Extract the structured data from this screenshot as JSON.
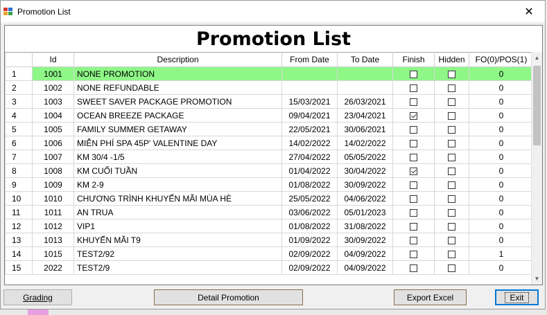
{
  "window": {
    "title": "Promotion List",
    "close_glyph": "✕"
  },
  "heading": "Promotion List",
  "table": {
    "columns": [
      "",
      "Id",
      "Description",
      "From Date",
      "To Date",
      "Finish",
      "Hidden",
      "FO(0)/POS(1)"
    ],
    "rows": [
      {
        "n": "1",
        "id": "1001",
        "desc": "NONE PROMOTION",
        "from": "",
        "to": "",
        "finish": false,
        "hidden": false,
        "fopos": "0",
        "selected": true
      },
      {
        "n": "2",
        "id": "1002",
        "desc": "NONE REFUNDABLE",
        "from": "",
        "to": "",
        "finish": false,
        "hidden": false,
        "fopos": "0"
      },
      {
        "n": "3",
        "id": "1003",
        "desc": "SWEET SAVER PACKAGE PROMOTION",
        "from": "15/03/2021",
        "to": "26/03/2021",
        "finish": false,
        "hidden": false,
        "fopos": "0"
      },
      {
        "n": "4",
        "id": "1004",
        "desc": "OCEAN BREEZE PACKAGE",
        "from": "09/04/2021",
        "to": "23/04/2021",
        "finish": true,
        "hidden": false,
        "fopos": "0"
      },
      {
        "n": "5",
        "id": "1005",
        "desc": "FAMILY SUMMER GETAWAY",
        "from": "22/05/2021",
        "to": "30/06/2021",
        "finish": false,
        "hidden": false,
        "fopos": "0"
      },
      {
        "n": "6",
        "id": "1006",
        "desc": "MIỄN PHÍ SPA 45P' VALENTINE DAY",
        "from": "14/02/2022",
        "to": "14/02/2022",
        "finish": false,
        "hidden": false,
        "fopos": "0"
      },
      {
        "n": "7",
        "id": "1007",
        "desc": "KM 30/4 -1/5",
        "from": "27/04/2022",
        "to": "05/05/2022",
        "finish": false,
        "hidden": false,
        "fopos": "0"
      },
      {
        "n": "8",
        "id": "1008",
        "desc": "KM CUỐI TUẦN",
        "from": "01/04/2022",
        "to": "30/04/2022",
        "finish": true,
        "hidden": false,
        "fopos": "0"
      },
      {
        "n": "9",
        "id": "1009",
        "desc": "KM 2-9",
        "from": "01/08/2022",
        "to": "30/09/2022",
        "finish": false,
        "hidden": false,
        "fopos": "0"
      },
      {
        "n": "10",
        "id": "1010",
        "desc": "CHƯƠNG TRÌNH KHUYẾN MÃI MÙA HÈ",
        "from": "25/05/2022",
        "to": "04/06/2022",
        "finish": false,
        "hidden": false,
        "fopos": "0"
      },
      {
        "n": "11",
        "id": "1011",
        "desc": "AN TRUA",
        "from": "03/06/2022",
        "to": "05/01/2023",
        "finish": false,
        "hidden": false,
        "fopos": "0"
      },
      {
        "n": "12",
        "id": "1012",
        "desc": "VIP1",
        "from": "01/08/2022",
        "to": "31/08/2022",
        "finish": false,
        "hidden": false,
        "fopos": "0"
      },
      {
        "n": "13",
        "id": "1013",
        "desc": "KHUYẾN MÃI T9",
        "from": "01/09/2022",
        "to": "30/09/2022",
        "finish": false,
        "hidden": false,
        "fopos": "0"
      },
      {
        "n": "14",
        "id": "1015",
        "desc": "TEST2/92",
        "from": "02/09/2022",
        "to": "04/09/2022",
        "finish": false,
        "hidden": false,
        "fopos": "1"
      },
      {
        "n": "15",
        "id": "2022",
        "desc": "TEST2/9",
        "from": "02/09/2022",
        "to": "04/09/2022",
        "finish": false,
        "hidden": false,
        "fopos": "0"
      }
    ]
  },
  "buttons": {
    "grading": "Grading",
    "detail": "Detail Promotion",
    "export": "Export Excel",
    "exit": "Exit"
  },
  "colors": {
    "selected_row": "#8ef787",
    "focus_border": "#0078d7"
  },
  "icons": {
    "app": "app-grid-icon",
    "close": "close-icon",
    "scroll_up": "scroll-up-icon",
    "scroll_down": "scroll-down-icon"
  }
}
